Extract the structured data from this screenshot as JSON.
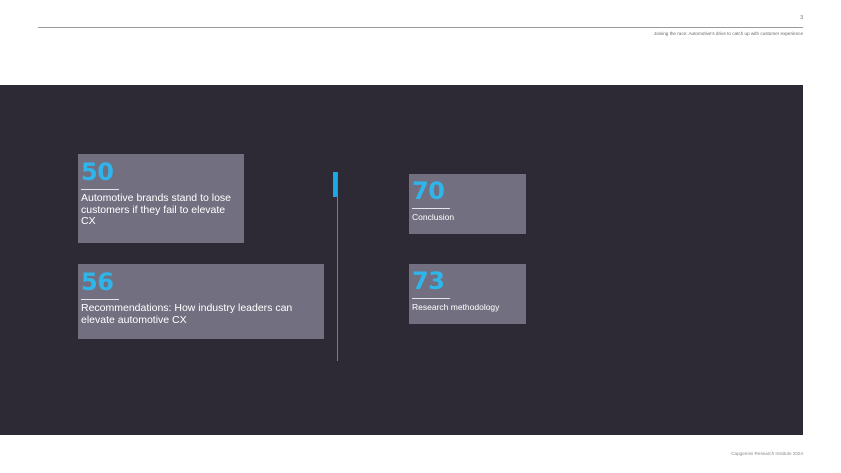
{
  "header": {
    "page_number": "3",
    "title": "Joining the race: Automotive's drive to catch up with customer experience"
  },
  "toc": {
    "items": [
      {
        "page": "50",
        "label": "Automotive brands stand to lose customers if they fail to elevate CX"
      },
      {
        "page": "56",
        "label": "Recommendations: How industry leaders can elevate automotive CX"
      },
      {
        "page": "70",
        "label": "Conclusion"
      },
      {
        "page": "73",
        "label": "Research methodology"
      }
    ]
  },
  "footer": {
    "text": "Capgemini Research Institute 2024"
  },
  "colors": {
    "panel": "#2e2a35",
    "card": "#726f80",
    "accent": "#2fb5ea"
  }
}
